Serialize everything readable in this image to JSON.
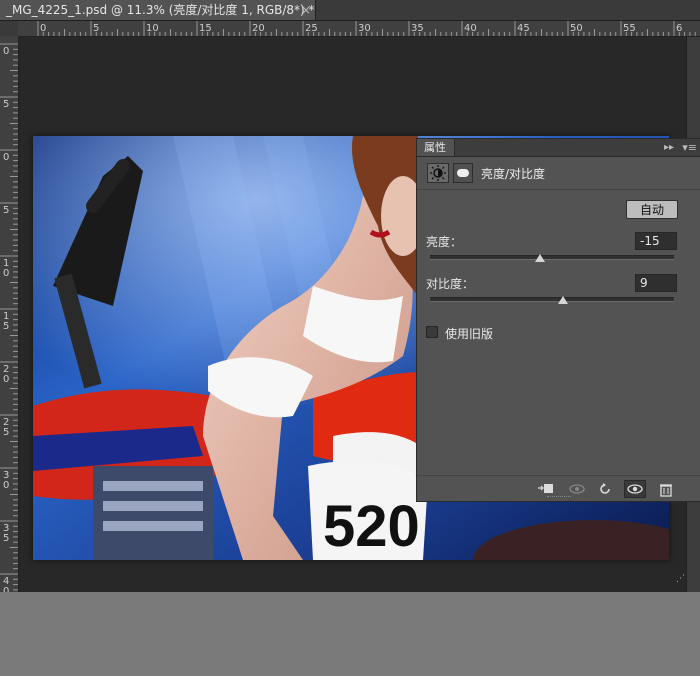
{
  "document": {
    "tab_title": "_MG_4225_1.psd @ 11.3% (亮度/对比度 1, RGB/8*) *",
    "close_label": "×"
  },
  "rulers": {
    "horizontal_labels": [
      "0",
      "5",
      "10",
      "15",
      "20",
      "25",
      "30",
      "35",
      "40",
      "45",
      "50",
      "55",
      "6"
    ],
    "vertical_labels": [
      "0",
      "5",
      "0",
      "5",
      "1\n0",
      "1\n5",
      "2\n0",
      "2\n5",
      "3\n0",
      "3\n5",
      "4\n0"
    ]
  },
  "properties_panel": {
    "tab_label": "属性",
    "collapse_icon": "double-chevron-right-icon",
    "menu_icon": "panel-menu-icon",
    "adjustment_icon": "brightness-contrast-icon",
    "mask_icon": "layer-mask-icon",
    "title": "亮度/对比度",
    "auto_button": "自动",
    "brightness": {
      "label": "亮度：",
      "value": "-15",
      "slider_fraction": 0.45
    },
    "contrast": {
      "label": "对比度：",
      "value": "9",
      "slider_fraction": 0.545
    },
    "legacy_checkbox": {
      "label": "使用旧版",
      "checked": false
    },
    "footer_icons": [
      "clip-to-layer-icon",
      "view-previous-state-icon",
      "reset-icon",
      "visibility-eye-icon",
      "delete-trash-icon"
    ]
  },
  "colors": {
    "panel_bg": "#535353",
    "workspace_bg": "#282828",
    "outer_bg": "#7a7a7a"
  }
}
